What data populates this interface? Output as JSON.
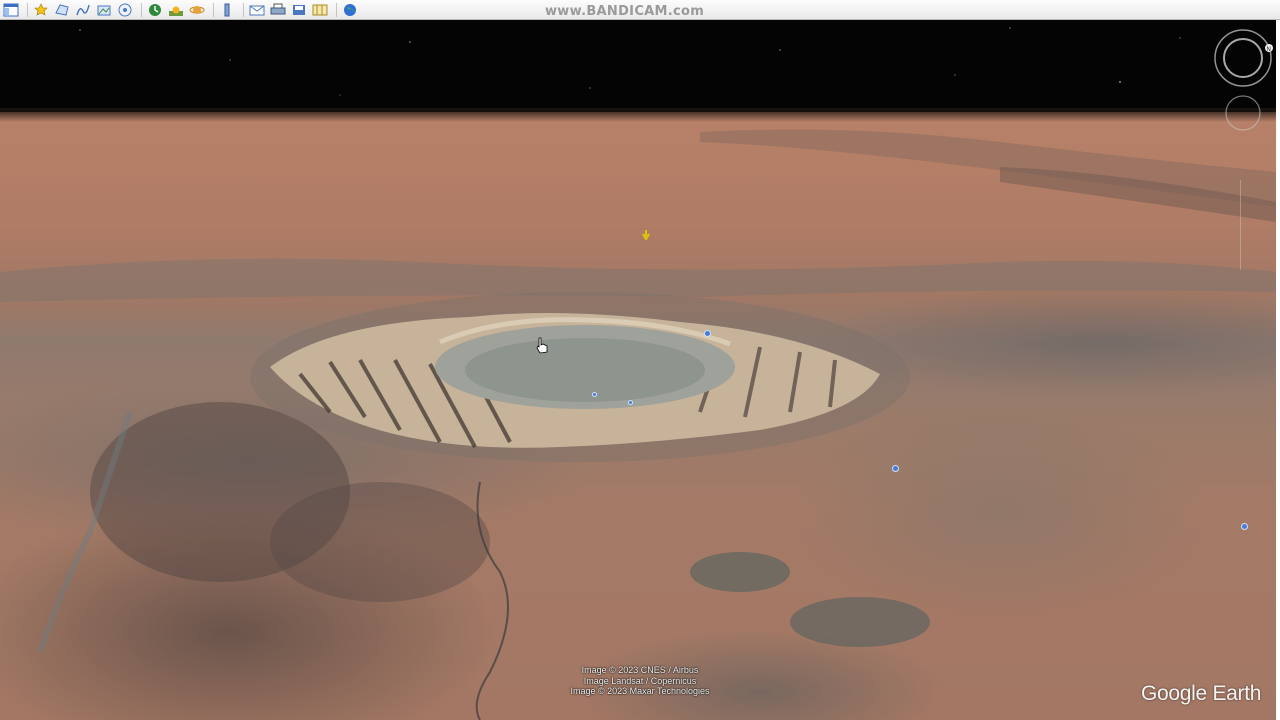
{
  "toolbar": {
    "buttons": [
      {
        "icon": "sidebar-icon"
      },
      {
        "icon": "placemark-icon"
      },
      {
        "icon": "polygon-icon"
      },
      {
        "icon": "path-icon"
      },
      {
        "icon": "overlay-icon"
      },
      {
        "icon": "tour-icon"
      },
      {
        "icon": "historical-imagery-icon"
      },
      {
        "icon": "sunlight-icon"
      },
      {
        "icon": "planets-icon"
      },
      {
        "icon": "ruler-icon"
      },
      {
        "icon": "email-icon"
      },
      {
        "icon": "print-icon"
      },
      {
        "icon": "save-image-icon"
      },
      {
        "icon": "view-in-maps-icon"
      },
      {
        "icon": "globe-icon"
      }
    ]
  },
  "watermark": "www.BANDICAM.com",
  "attribution": [
    "Image © 2023 CNES / Airbus",
    "Image Landsat / Copernicus",
    "Image © 2023 Maxar Technologies"
  ],
  "logo": "Google Earth"
}
